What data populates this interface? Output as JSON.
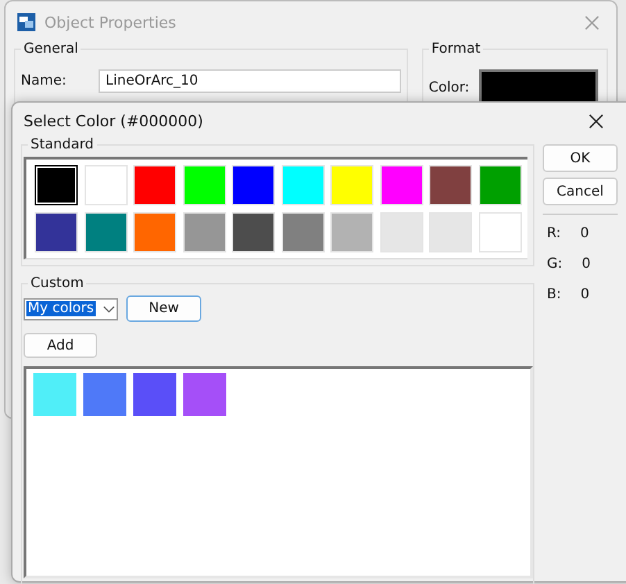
{
  "back_window": {
    "title": "Object Properties",
    "general": {
      "title": "General",
      "name_label": "Name:",
      "name_value": "LineOrArc_10"
    },
    "format": {
      "title": "Format",
      "color_label": "Color:",
      "color": "#000000"
    }
  },
  "dialog": {
    "title": "Select Color (#000000)",
    "standard": {
      "title": "Standard",
      "colors": [
        {
          "color": "#000000",
          "selected": true
        },
        {
          "color": "#ffffff",
          "selected": false
        },
        {
          "color": "#ff0000",
          "selected": false
        },
        {
          "color": "#00ff00",
          "selected": false
        },
        {
          "color": "#0000ff",
          "selected": false
        },
        {
          "color": "#00ffff",
          "selected": false
        },
        {
          "color": "#ffff00",
          "selected": false
        },
        {
          "color": "#ff00ff",
          "selected": false
        },
        {
          "color": "#804040",
          "selected": false
        },
        {
          "color": "#00a000",
          "selected": false
        },
        {
          "color": "#333399",
          "selected": false
        },
        {
          "color": "#008080",
          "selected": false
        },
        {
          "color": "#ff6600",
          "selected": false
        },
        {
          "color": "#969696",
          "selected": false
        },
        {
          "color": "#4d4d4d",
          "selected": false
        },
        {
          "color": "#808080",
          "selected": false
        },
        {
          "color": "#b2b2b2",
          "selected": false
        },
        {
          "color": "#e6e6e6",
          "selected": false
        },
        {
          "color": "#e6e6e6",
          "selected": false
        },
        {
          "color": "#ffffff",
          "selected": false
        }
      ]
    },
    "custom": {
      "title": "Custom",
      "dropdown_value": "My colors",
      "new_button": "New",
      "add_button": "Add",
      "colors": [
        {
          "color": "#50eef8"
        },
        {
          "color": "#4f79f8"
        },
        {
          "color": "#5a4ff8"
        },
        {
          "color": "#a54ff8"
        }
      ]
    },
    "buttons": [
      "OK",
      "Cancel"
    ],
    "rgb": [
      {
        "label": "R:",
        "value": "0"
      },
      {
        "label": "G:",
        "value": "0"
      },
      {
        "label": "B:",
        "value": "0"
      }
    ]
  }
}
